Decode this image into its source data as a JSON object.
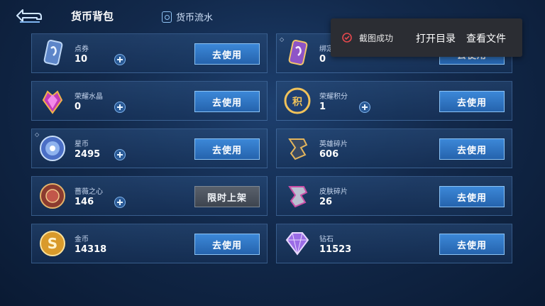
{
  "header": {
    "back_icon": "back-arrow-icon",
    "tab_active": "货币背包",
    "tab_other": "货币流水"
  },
  "use_label": "去使用",
  "limited_label": "限时上架",
  "left_items": [
    {
      "name": "点券",
      "count": "10",
      "icon": "voucher-icon",
      "button": "去使用"
    },
    {
      "name": "荣耀水晶",
      "count": "0",
      "icon": "glory-crystal-icon",
      "button": "去使用"
    },
    {
      "name": "星币",
      "count": "2495",
      "icon": "star-coin-icon",
      "button": "去使用"
    },
    {
      "name": "蔷薇之心",
      "count": "146",
      "icon": "rose-heart-icon",
      "button": "限时上架"
    },
    {
      "name": "金币",
      "count": "14318",
      "icon": "gold-coin-icon",
      "button": "去使用"
    }
  ],
  "right_items": [
    {
      "name": "绑定",
      "count": "0",
      "icon": "bound-voucher-icon",
      "button": "去使用"
    },
    {
      "name": "荣耀积分",
      "count": "1",
      "icon": "glory-points-icon",
      "button": "去使用"
    },
    {
      "name": "英雄碎片",
      "count": "606",
      "icon": "hero-fragment-icon",
      "button": "去使用"
    },
    {
      "name": "皮肤碎片",
      "count": "26",
      "icon": "skin-fragment-icon",
      "button": "去使用"
    },
    {
      "name": "钻石",
      "count": "11523",
      "icon": "diamond-icon",
      "button": "去使用"
    }
  ],
  "toast": {
    "message": "截图成功",
    "action_open": "打开目录",
    "action_view": "查看文件"
  },
  "colors": {
    "accent_button": "#2f74c4",
    "disabled_button": "#4a525d",
    "toast_bg": "#2b2d33",
    "success_red": "#e5484d"
  }
}
